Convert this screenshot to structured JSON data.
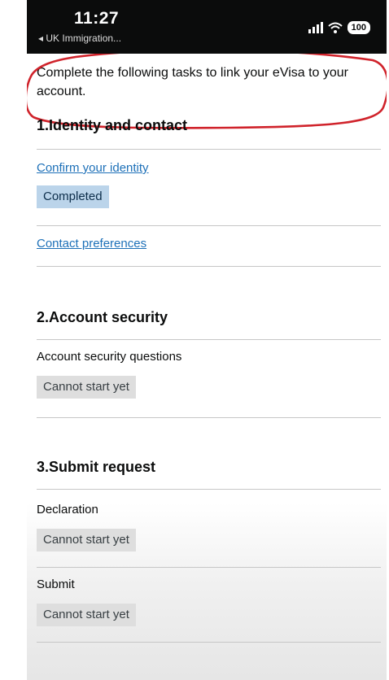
{
  "status_bar": {
    "time": "11:27",
    "back_app": "◂ UK Immigration...",
    "battery": "100"
  },
  "intro": "Complete the following tasks to link your eVisa to your account.",
  "sections": [
    {
      "heading": "1.Identity and contact",
      "tasks": [
        {
          "label": "Confirm your identity",
          "status": "Completed",
          "is_link": true
        },
        {
          "label": "Contact preferences",
          "status": "",
          "is_link": true
        }
      ]
    },
    {
      "heading": "2.Account security",
      "tasks": [
        {
          "label": "Account security questions",
          "status": "Cannot start yet",
          "is_link": false
        }
      ]
    },
    {
      "heading": "3.Submit request",
      "tasks": [
        {
          "label": "Declaration",
          "status": "Cannot start yet",
          "is_link": false
        },
        {
          "label": "Submit",
          "status": "Cannot start yet",
          "is_link": false
        }
      ]
    }
  ],
  "colors": {
    "link": "#1d70b8",
    "completed_tag": "#bbd4ea",
    "blocked_tag": "#dedede",
    "annotation": "#d0232b"
  }
}
